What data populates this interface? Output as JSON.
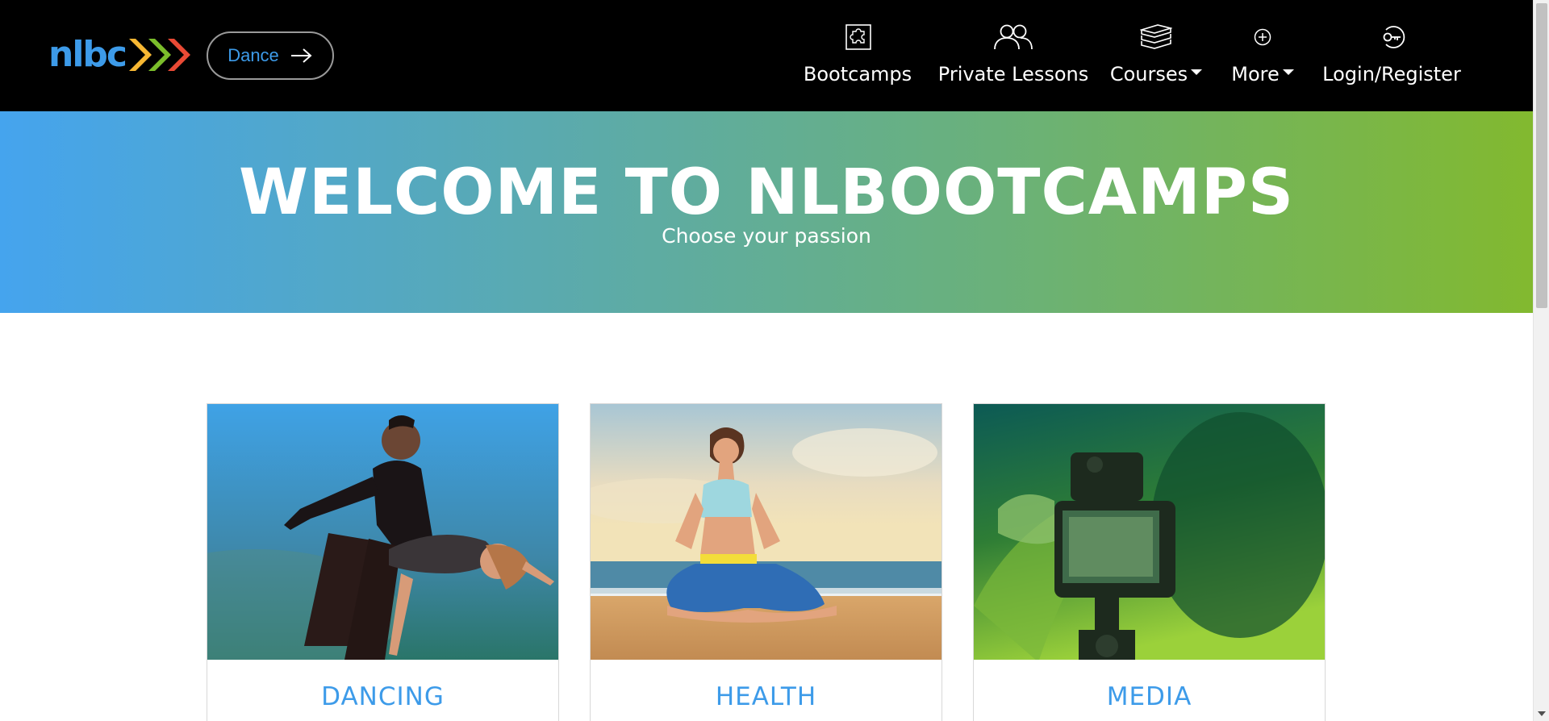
{
  "header": {
    "logo_text": "nlbc",
    "dance_button": "Dance",
    "nav": [
      {
        "label": "Bootcamps",
        "icon": "puzzle-icon"
      },
      {
        "label": "Private Lessons",
        "icon": "users-icon"
      },
      {
        "label": "Courses",
        "icon": "books-icon",
        "dropdown": true
      },
      {
        "label": "More",
        "icon": "plus-circle-icon",
        "dropdown": true
      },
      {
        "label": "Login/Register",
        "icon": "key-icon"
      }
    ]
  },
  "hero": {
    "title": "WELCOME TO NLBOOTCAMPS",
    "subtitle": "Choose your passion"
  },
  "cards": [
    {
      "title": "DANCING",
      "image": "ballroom-dancers-photo"
    },
    {
      "title": "HEALTH",
      "image": "yoga-beach-photo"
    },
    {
      "title": "MEDIA",
      "image": "camera-photographer-photo"
    }
  ],
  "colors": {
    "accent_blue": "#3d9be9",
    "header_bg": "#000000",
    "gradient_start": "#45a4ee",
    "gradient_end": "#82b92f"
  }
}
